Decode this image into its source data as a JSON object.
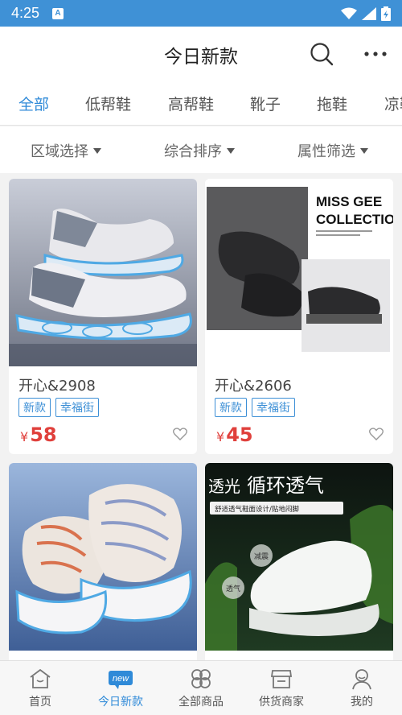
{
  "status": {
    "time": "4:25",
    "notif": "A"
  },
  "header": {
    "title": "今日新款"
  },
  "tabs": [
    {
      "label": "全部",
      "active": true
    },
    {
      "label": "低帮鞋"
    },
    {
      "label": "高帮鞋"
    },
    {
      "label": "靴子"
    },
    {
      "label": "拖鞋"
    },
    {
      "label": "凉鞋"
    }
  ],
  "filters": [
    "区域选择",
    "综合排序",
    "属性筛选"
  ],
  "products": [
    {
      "name": "开心&2908",
      "tags": [
        "新款",
        "幸福街"
      ],
      "currency": "¥",
      "price": "58"
    },
    {
      "name": "开心&2606",
      "tags": [
        "新款",
        "幸福街"
      ],
      "currency": "¥",
      "price": "45",
      "image_text": [
        "MISS GEE",
        "COLLECTION"
      ]
    },
    {
      "name": ""
    },
    {
      "name": "",
      "image_text": [
        "透光",
        "循环透气",
        "舒适透气鞋面设计/贴地闷脚",
        "减震",
        "透气"
      ]
    }
  ],
  "bottom_nav": [
    {
      "label": "首页",
      "icon": "home-icon"
    },
    {
      "label": "今日新款",
      "icon": "new-badge-icon",
      "badge": "new",
      "active": true
    },
    {
      "label": "全部商品",
      "icon": "flower-grid-icon"
    },
    {
      "label": "供货商家",
      "icon": "shop-icon"
    },
    {
      "label": "我的",
      "icon": "user-icon"
    }
  ],
  "colors": {
    "accent": "#2f8ad8",
    "price": "#e0403c",
    "statusbar": "#3f91d6"
  }
}
